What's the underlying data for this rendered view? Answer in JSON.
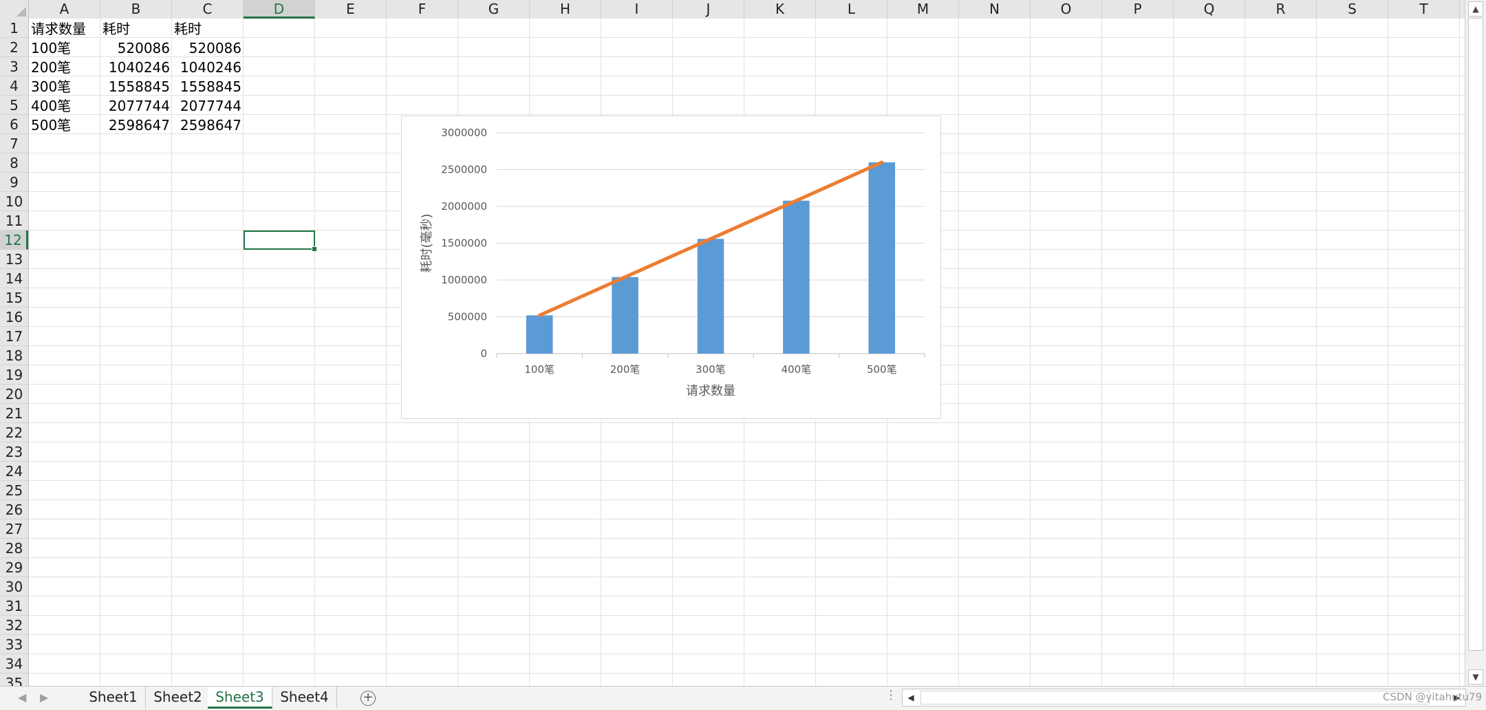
{
  "columns": [
    "A",
    "B",
    "C",
    "D",
    "E",
    "F",
    "G",
    "H",
    "I",
    "J",
    "K",
    "L",
    "M",
    "N",
    "O",
    "P",
    "Q",
    "R",
    "S",
    "T"
  ],
  "selected_column": "D",
  "rows": [
    "1",
    "2",
    "3",
    "4",
    "5",
    "6",
    "7",
    "8",
    "9",
    "10",
    "11",
    "12",
    "13",
    "14",
    "15",
    "16",
    "17",
    "18",
    "19",
    "20",
    "21",
    "22",
    "23",
    "24",
    "25",
    "26",
    "27",
    "28",
    "29",
    "30",
    "31",
    "32",
    "33",
    "34",
    "35"
  ],
  "selected_row": "12",
  "cells": {
    "A1": "请求数量",
    "B1": "耗时",
    "C1": "耗时",
    "A2": "100笔",
    "B2": "520086",
    "C2": "520086",
    "A3": "200笔",
    "B3": "1040246",
    "C3": "1040246",
    "A4": "300笔",
    "B4": "1558845",
    "C4": "1558845",
    "A5": "400笔",
    "B5": "2077744",
    "C5": "2077744",
    "A6": "500笔",
    "B6": "2598647",
    "C6": "2598647"
  },
  "chart_data": {
    "type": "bar",
    "categories": [
      "100笔",
      "200笔",
      "300笔",
      "400笔",
      "500笔"
    ],
    "series": [
      {
        "kind": "bar",
        "values": [
          520086,
          1040246,
          1558845,
          2077744,
          2598647
        ],
        "color": "#5B9BD5"
      },
      {
        "kind": "line",
        "values": [
          520086,
          1040246,
          1558845,
          2077744,
          2598647
        ],
        "color": "#ED7D31"
      }
    ],
    "xlabel": "请求数量",
    "ylabel": "耗时(毫秒)",
    "ylim": [
      0,
      3000000
    ],
    "yticks": [
      "0",
      "500000",
      "1000000",
      "1500000",
      "2000000",
      "2500000",
      "3000000"
    ],
    "grid": true
  },
  "sheets": [
    "Sheet1",
    "Sheet2",
    "Sheet3",
    "Sheet4"
  ],
  "active_sheet": "Sheet3",
  "watermark": "CSDN @yitahutu79"
}
